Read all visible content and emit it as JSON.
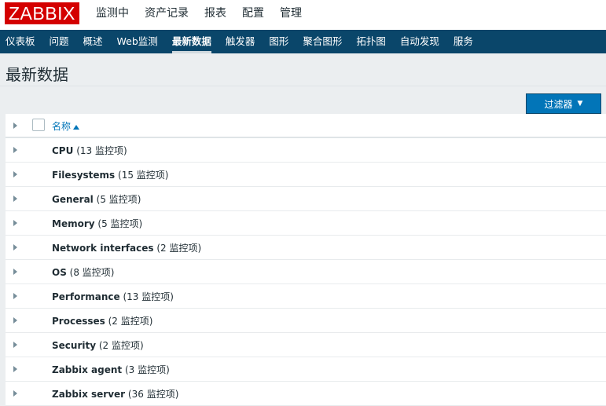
{
  "app": {
    "logo": "ZABBIX",
    "brand_color": "#d40000"
  },
  "main_menu": [
    {
      "label": "监测中",
      "active": true
    },
    {
      "label": "资产记录",
      "active": false
    },
    {
      "label": "报表",
      "active": false
    },
    {
      "label": "配置",
      "active": false
    },
    {
      "label": "管理",
      "active": false
    }
  ],
  "sub_nav": [
    {
      "label": "仪表板",
      "active": false
    },
    {
      "label": "问题",
      "active": false
    },
    {
      "label": "概述",
      "active": false
    },
    {
      "label": "Web监测",
      "active": false
    },
    {
      "label": "最新数据",
      "active": true
    },
    {
      "label": "触发器",
      "active": false
    },
    {
      "label": "图形",
      "active": false
    },
    {
      "label": "聚合图形",
      "active": false
    },
    {
      "label": "拓扑图",
      "active": false
    },
    {
      "label": "自动发现",
      "active": false
    },
    {
      "label": "服务",
      "active": false
    }
  ],
  "page": {
    "title": "最新数据",
    "filter_button": "过滤器"
  },
  "table": {
    "header_name": "名称",
    "rows": [
      {
        "name": "CPU",
        "count": "(13 监控项)"
      },
      {
        "name": "Filesystems",
        "count": "(15 监控项)"
      },
      {
        "name": "General",
        "count": "(5 监控项)"
      },
      {
        "name": "Memory",
        "count": "(5 监控项)"
      },
      {
        "name": "Network interfaces",
        "count": "(2 监控项)"
      },
      {
        "name": "OS",
        "count": "(8 监控项)"
      },
      {
        "name": "Performance",
        "count": "(13 监控项)"
      },
      {
        "name": "Processes",
        "count": "(2 监控项)"
      },
      {
        "name": "Security",
        "count": "(2 监控项)"
      },
      {
        "name": "Zabbix agent",
        "count": "(3 监控项)"
      },
      {
        "name": "Zabbix server",
        "count": "(36 监控项)"
      }
    ]
  },
  "colors": {
    "nav_bg": "#0a466a",
    "accent": "#0275b8",
    "page_bg": "#ebeef0"
  }
}
